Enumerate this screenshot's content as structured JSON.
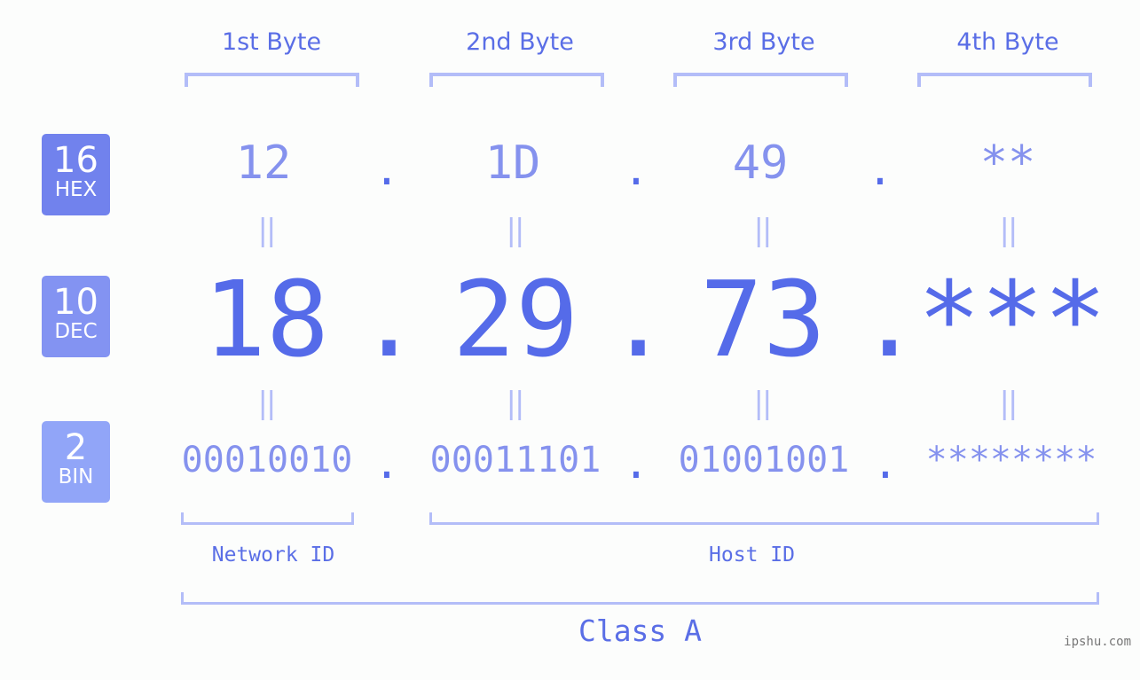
{
  "byte_headers": [
    "1st Byte",
    "2nd Byte",
    "3rd Byte",
    "4th Byte"
  ],
  "badges": [
    {
      "base": "16",
      "label": "HEX",
      "color": "#7182ed"
    },
    {
      "base": "10",
      "label": "DEC",
      "color": "#8393f2"
    },
    {
      "base": "2",
      "label": "BIN",
      "color": "#91a5f8"
    }
  ],
  "hex": [
    "12",
    "1D",
    "49",
    "**"
  ],
  "dec": [
    "18",
    "29",
    "73",
    "***"
  ],
  "bin": [
    "00010010",
    "00011101",
    "01001001",
    "********"
  ],
  "separator": ".",
  "equals": "||",
  "network_id_label": "Network ID",
  "host_id_label": "Host ID",
  "class_label": "Class A",
  "watermark": "ipshu.com",
  "colors": {
    "primary_text": "#5a6ee6",
    "light_value": "#8592ee",
    "bracket": "#b3bdf8",
    "background": "#fcfdfc"
  }
}
